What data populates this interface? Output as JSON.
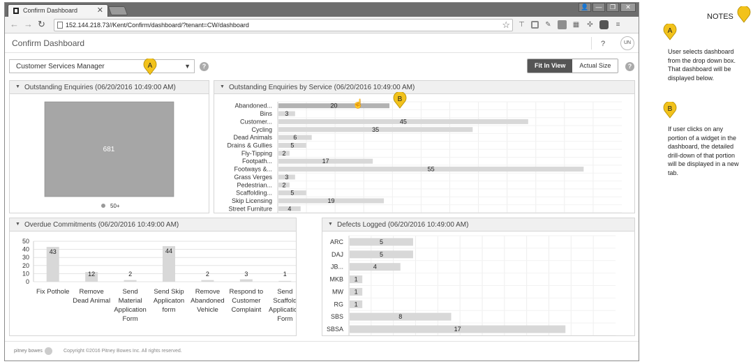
{
  "browser": {
    "tab_title": "Confirm Dashboard",
    "tab_close": "✕",
    "url": "152.144.218.73//Kent/Confirm/dashboard/?tenant=CW/dashboard",
    "window_buttons": [
      "👤",
      "—",
      "❐",
      "✕"
    ]
  },
  "app": {
    "title": "Confirm Dashboard",
    "help": "?",
    "user_initials": "UN",
    "dashboard_select": {
      "value": "Customer Services Manager"
    },
    "view_toggle": {
      "fit_label": "Fit In View",
      "actual_label": "Actual Size",
      "active": "fit"
    }
  },
  "panels": {
    "outstanding": {
      "title": "Outstanding Enquiries (06/20/2016 10:49:00 AM)"
    },
    "by_service": {
      "title": "Outstanding Enquiries by Service (06/20/2016 10:49:00 AM)"
    },
    "overdue": {
      "title": "Overdue Commitments (06/20/2016 10:49:00 AM)"
    },
    "defects": {
      "title": "Defects Logged (06/20/2016 10:49:00 AM)"
    }
  },
  "chart_data": [
    {
      "id": "outstanding",
      "type": "heatmap",
      "values": [
        681
      ],
      "legend": [
        "50+"
      ],
      "colors": [
        "#a6a6a6"
      ]
    },
    {
      "id": "by_service",
      "type": "bar",
      "orientation": "horizontal",
      "categories": [
        "Abandoned...",
        "Bins",
        "Customer...",
        "Cycling",
        "Dead Animals",
        "Drains & Gullies",
        "Fly-Tipping",
        "Footpath...",
        "Footways &...",
        "Grass Verges",
        "Pedestrian...",
        "Scaffolding...",
        "Skip Licensing",
        "Street Furniture"
      ],
      "values": [
        20,
        3,
        45,
        35,
        6,
        5,
        2,
        17,
        55,
        3,
        2,
        5,
        19,
        4
      ],
      "xlim": [
        0,
        62
      ],
      "grid": true,
      "highlight_index": 0,
      "colors": {
        "bar": "#d8d8d8",
        "highlight": "#b3b3b3"
      }
    },
    {
      "id": "overdue",
      "type": "bar",
      "categories": [
        "Fix Pothole",
        "Remove Dead Animal",
        "Send Material Application Form",
        "Send Skip Applicaton form",
        "Remove Abandoned Vehicle",
        "Respond to Customer Complaint",
        "Send Scaffold Application Form"
      ],
      "category_lines": [
        [
          "Fix Pothole"
        ],
        [
          "Remove",
          "Dead Animal"
        ],
        [
          "Send",
          "Material",
          "Application",
          "Form"
        ],
        [
          "Send Skip",
          "Applicaton",
          "form"
        ],
        [
          "Remove",
          "Abandoned",
          "Vehicle"
        ],
        [
          "Respond to",
          "Customer",
          "Complaint"
        ],
        [
          "Send",
          "Scaffold",
          "Application",
          "Form"
        ]
      ],
      "values": [
        43,
        12,
        2,
        44,
        2,
        3,
        1
      ],
      "yticks": [
        0,
        10,
        20,
        30,
        40,
        50
      ],
      "ylim": [
        0,
        50
      ],
      "grid": true,
      "colors": {
        "bar": "#d8d8d8"
      }
    },
    {
      "id": "defects",
      "type": "bar",
      "orientation": "horizontal",
      "categories": [
        "ARC",
        "DAJ",
        "JB...",
        "MKB",
        "MW",
        "RG",
        "SBS",
        "SBSA"
      ],
      "values": [
        5,
        5,
        4,
        1,
        1,
        1,
        8,
        17
      ],
      "xlim": [
        0,
        21
      ],
      "grid": true,
      "colors": {
        "bar": "#d8d8d8"
      }
    }
  ],
  "annotations": {
    "marker_color": "#f2c21b",
    "markers": [
      {
        "letter": "A"
      },
      {
        "letter": "B"
      }
    ]
  },
  "notes": {
    "title": "NOTES",
    "items": [
      {
        "letter": "A",
        "text": "User selects dashboard from the drop down box. That dashboard will be displayed below."
      },
      {
        "letter": "B",
        "text": "If user clicks on any portion of a widget in the dashboard, the detailed drill-down of that portion will be displayed in a new tab."
      }
    ]
  },
  "footer": {
    "logo": "pitney bowes",
    "copyright": "Copyright ©2016 Pitney Bowes Inc. All rights reserved."
  }
}
